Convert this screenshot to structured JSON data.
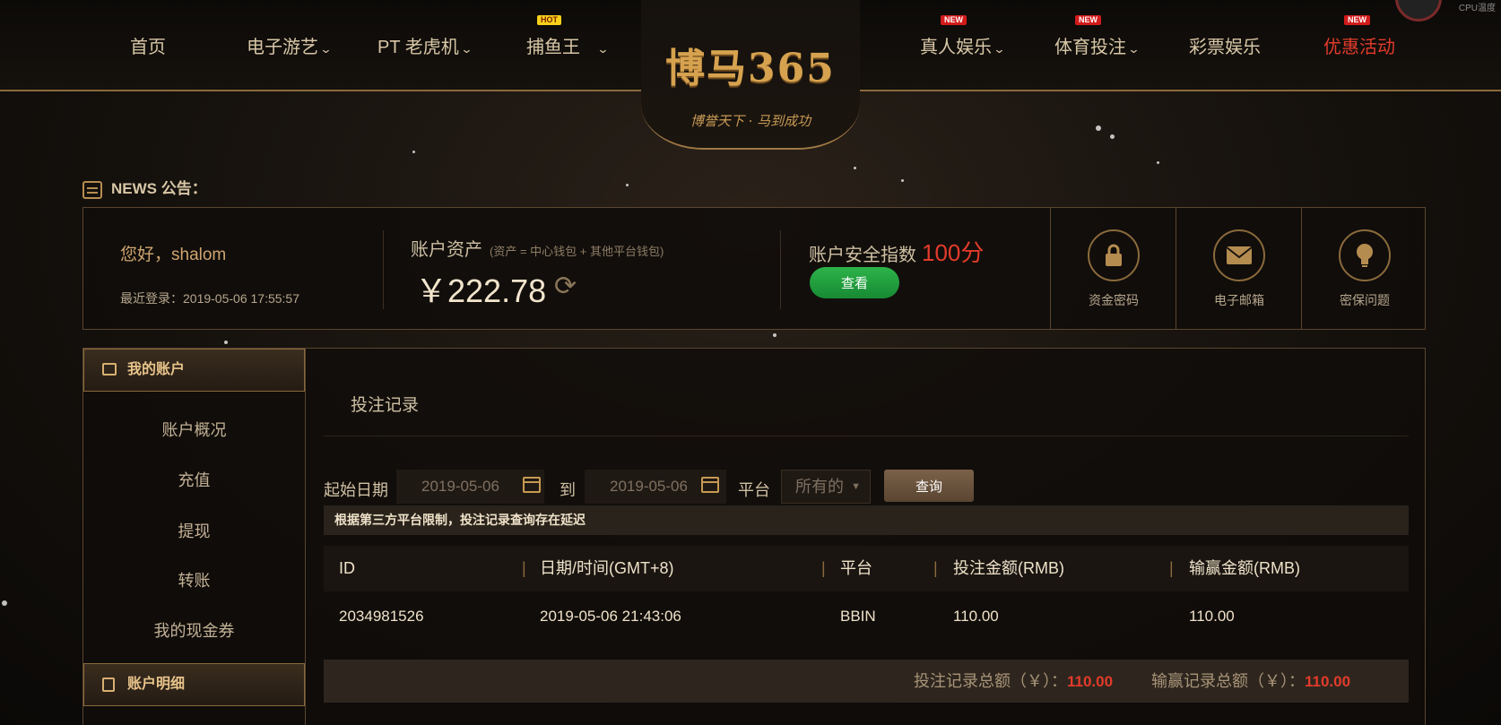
{
  "nav": {
    "items": [
      {
        "label": "首页"
      },
      {
        "label": "电子游艺"
      },
      {
        "label": "PT 老虎机"
      },
      {
        "label": "捕鱼王",
        "tag": "HOT"
      },
      {
        "label": "真人娱乐",
        "tag": "NEW"
      },
      {
        "label": "体育投注",
        "tag": "NEW"
      },
      {
        "label": "彩票娱乐"
      },
      {
        "label": "优惠活动",
        "tag": "NEW"
      }
    ],
    "chevron": "⌄"
  },
  "logo": {
    "main": "博马365",
    "slogan": "博誉天下 · 马到成功"
  },
  "cpu": {
    "label": "CPU温度"
  },
  "news": {
    "label": "NEWS 公告："
  },
  "account": {
    "greeting": "您好，shalom",
    "last_login": "最近登录：2019-05-06 17:55:57",
    "assets_title": "账户资产",
    "assets_note": "(资产 = 中心钱包 + 其他平台钱包)",
    "assets_value": "￥222.78",
    "security_title": "账户安全指数",
    "security_score": "100分",
    "view_button": "查看",
    "security_items": [
      {
        "label": "资金密码",
        "icon": "lock-icon"
      },
      {
        "label": "电子邮箱",
        "icon": "mail-icon"
      },
      {
        "label": "密保问题",
        "icon": "lightbulb-icon"
      }
    ]
  },
  "sidebar": {
    "section1": "我的账户",
    "items": [
      "账户概况",
      "充值",
      "提现",
      "转账",
      "我的现金券"
    ],
    "section2": "账户明细"
  },
  "main": {
    "title": "投注记录",
    "filter": {
      "start_label": "起始日期",
      "start_value": "2019-05-06",
      "to_label": "到",
      "end_value": "2019-05-06",
      "platform_label": "平台",
      "platform_value": "所有的",
      "query_button": "查询"
    },
    "notice": "根据第三方平台限制，投注记录查询存在延迟",
    "columns": [
      "ID",
      "日期/时间(GMT+8)",
      "平台",
      "投注金额(RMB)",
      "输赢金额(RMB)"
    ],
    "rows": [
      [
        "2034981526",
        "2019-05-06 21:43:06",
        "BBIN",
        "110.00",
        "110.00"
      ]
    ],
    "totals": {
      "bet_label": "投注记录总额（￥）：",
      "bet_value": "110.00",
      "win_label": "输赢记录总额（￥）：",
      "win_value": "110.00"
    }
  }
}
